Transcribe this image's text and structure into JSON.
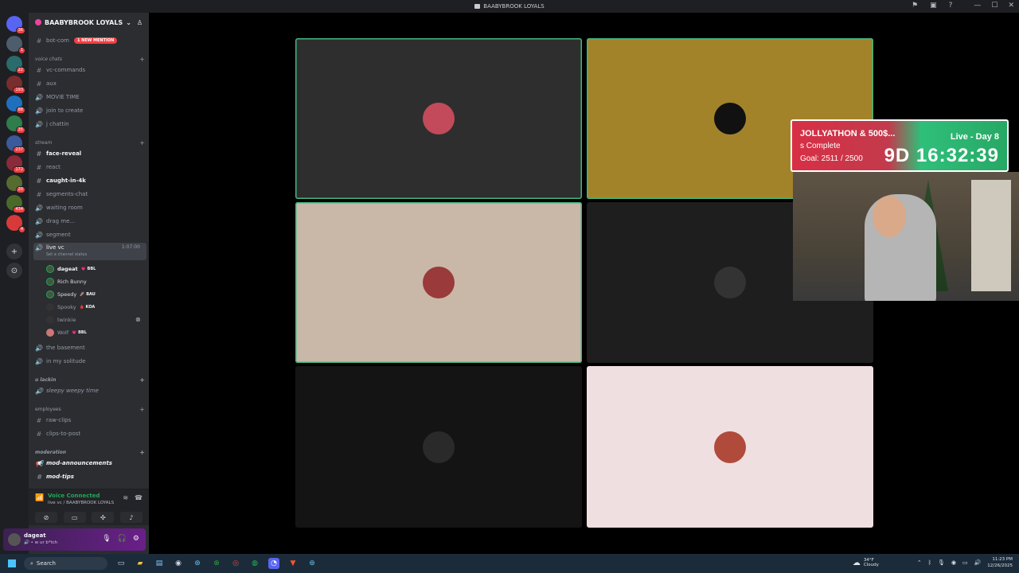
{
  "window": {
    "title": "BAABYBROOK LOYALS",
    "controls": [
      "—",
      "☐",
      "✕"
    ]
  },
  "guilds": [
    {
      "badge": "36",
      "color": "#5865f2"
    },
    {
      "badge": "1",
      "color": "#4e5d6c"
    },
    {
      "badge": "22",
      "color": "#2a6b6b"
    },
    {
      "badge": "193",
      "color": "#7a2d2d"
    },
    {
      "badge": "88",
      "color": "#1f6fbf"
    },
    {
      "badge": "35",
      "color": "#2e7d4a"
    },
    {
      "badge": "237",
      "color": "#3a5a9a"
    },
    {
      "badge": "172",
      "color": "#8a2a3a"
    },
    {
      "badge": "20",
      "color": "#556b2f"
    },
    {
      "badge": "434",
      "color": "#4a6a2a"
    },
    {
      "badge": "4",
      "color": "#d83a3a"
    }
  ],
  "server": {
    "name": "BAABYBROOK LOYALS"
  },
  "channels": {
    "top": {
      "name": "bot-com",
      "mention": "1 NEW MENTION"
    },
    "cat_voice": "voice chats",
    "vc_commands": "vc-commands",
    "aux": "aux",
    "movie_time": "MOVIE TIME",
    "join_to_create": "join to create",
    "j_chattin": "j chattin",
    "cat_stream": "stream",
    "face_reveal": "face-reveal",
    "react": "react",
    "caught_in_4k": "caught-in-4k",
    "segments_chat": "segments-chat",
    "waiting_room": "waiting room",
    "drag_me": "drag me...",
    "segment": "segment",
    "live_vc": "live vc",
    "live_vc_status": "Set a channel status",
    "live_vc_timer": "1:07:00",
    "vc_users": [
      {
        "name": "dageat",
        "tag": "💗 BBL"
      },
      {
        "name": "Rich Bunny",
        "tag": ""
      },
      {
        "name": "Speedy",
        "tag": "🚀 BAU"
      },
      {
        "name": "Spooky",
        "tag": "🩸 KOA"
      },
      {
        "name": "twinkie",
        "tag": ""
      },
      {
        "name": "Wolf",
        "tag": "💗 BBL"
      }
    ],
    "the_basement": "the basement",
    "in_my_solitude": "in my solitude",
    "cat_u_lackin": "u lackin",
    "sleepy_weepy_time": "sleepy weepy time",
    "cat_employees": "employees",
    "raw_clips": "raw-clips",
    "clips_to_post": "clips-to-post",
    "cat_moderation": "moderation",
    "mod_announcements": "mod-announcements",
    "mod_tips": "mod-tips"
  },
  "voice_panel": {
    "status": "Voice Connected",
    "location": "live vc / BAABYBROOK LOYALS"
  },
  "user_panel": {
    "name": "dageat",
    "subtitle": "🔊 • w ur b*tch"
  },
  "tiles": [
    {
      "id": "tile-1",
      "bg": "#2e2e2e",
      "speaking": true,
      "avatar_color": "#c24a5a"
    },
    {
      "id": "tile-2",
      "bg": "#a3832a",
      "speaking": true,
      "avatar_color": "#111111"
    },
    {
      "id": "tile-3",
      "bg": "#c9b8a8",
      "speaking": true,
      "avatar_color": "#9a3a3a"
    },
    {
      "id": "tile-4",
      "bg": "#1e1e1e",
      "speaking": false,
      "avatar_color": "#333333"
    },
    {
      "id": "tile-5",
      "bg": "#141414",
      "speaking": false,
      "avatar_color": "#2a2a2a"
    },
    {
      "id": "tile-6",
      "bg": "#f0dfe0",
      "speaking": false,
      "avatar_color": "#b04a3a"
    }
  ],
  "overlay": {
    "title": "JOLLYATHON & 500$...",
    "subtitle": "s Complete",
    "goal": "Goal: 2511 / 2500",
    "live": "Live - Day 8",
    "timer": "9D 16:32:39"
  },
  "taskbar": {
    "search_placeholder": "Search",
    "weather_temp": "34°F",
    "weather_desc": "Cloudy",
    "time": "11:23 PM",
    "date": "12/26/2025"
  }
}
